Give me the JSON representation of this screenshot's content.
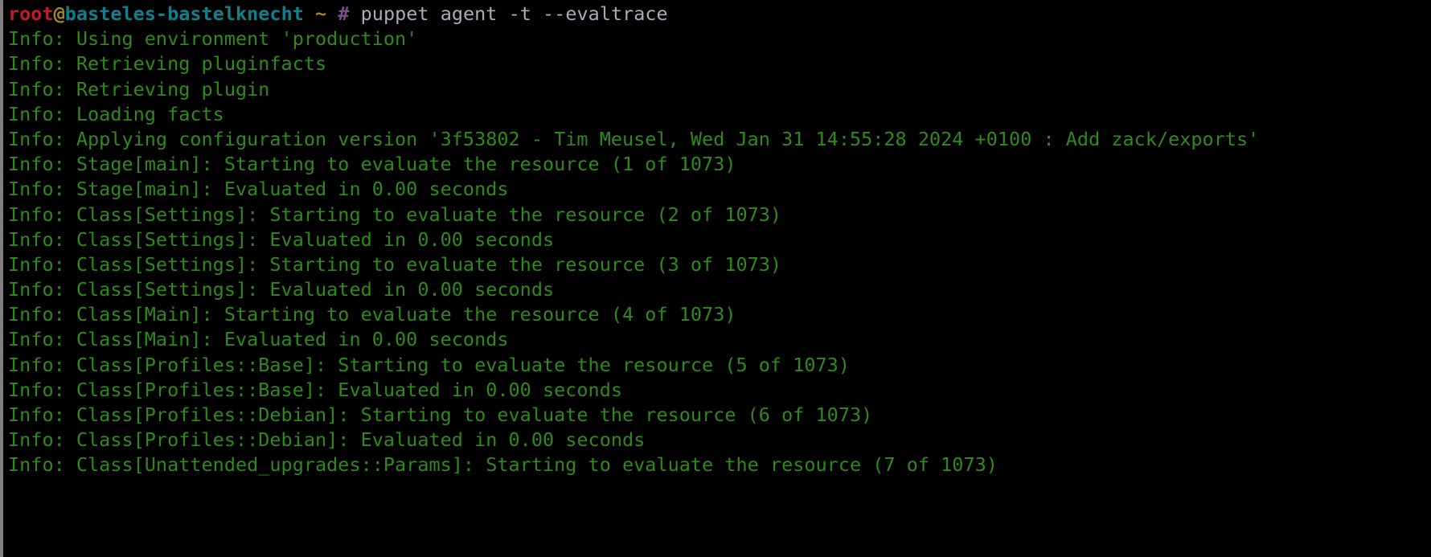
{
  "terminal": {
    "title": "root@basteles-bastelknecht: ~",
    "background_color": "#000000",
    "border_color": "#808080",
    "colors": {
      "green": "#2f8a1c",
      "red": "#c01c28",
      "yellow": "#a2891f",
      "teal": "#12808a",
      "purple": "#7b4f8c",
      "command_gray": "#a6adb8"
    },
    "prompt": {
      "user": "root",
      "at": "@",
      "host": "basteles-bastelknecht",
      "space1": " ",
      "path": "~",
      "space2": " ",
      "sigil": "#",
      "space3": " ",
      "command": "puppet agent -t --evaltrace"
    },
    "output_lines": [
      "Info: Using environment 'production'",
      "Info: Retrieving pluginfacts",
      "Info: Retrieving plugin",
      "Info: Loading facts",
      "Info: Applying configuration version '3f53802 - Tim Meusel, Wed Jan 31 14:55:28 2024 +0100 : Add zack/exports'",
      "Info: Stage[main]: Starting to evaluate the resource (1 of 1073)",
      "Info: Stage[main]: Evaluated in 0.00 seconds",
      "Info: Class[Settings]: Starting to evaluate the resource (2 of 1073)",
      "Info: Class[Settings]: Evaluated in 0.00 seconds",
      "Info: Class[Settings]: Starting to evaluate the resource (3 of 1073)",
      "Info: Class[Settings]: Evaluated in 0.00 seconds",
      "Info: Class[Main]: Starting to evaluate the resource (4 of 1073)",
      "Info: Class[Main]: Evaluated in 0.00 seconds",
      "Info: Class[Profiles::Base]: Starting to evaluate the resource (5 of 1073)",
      "Info: Class[Profiles::Base]: Evaluated in 0.00 seconds",
      "Info: Class[Profiles::Debian]: Starting to evaluate the resource (6 of 1073)",
      "Info: Class[Profiles::Debian]: Evaluated in 0.00 seconds",
      "Info: Class[Unattended_upgrades::Params]: Starting to evaluate the resource (7 of 1073)"
    ]
  }
}
